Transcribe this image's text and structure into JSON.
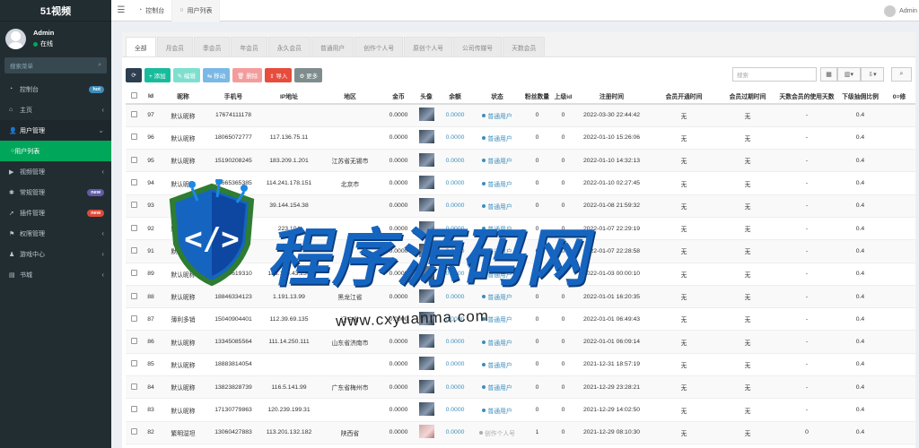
{
  "brand": "51视频",
  "user": {
    "name": "Admin",
    "status": "在线"
  },
  "sidebar": {
    "search_placeholder": "搜索菜单",
    "items": [
      {
        "label": "控制台",
        "icon": "dashboard-icon",
        "badge": "hot"
      },
      {
        "label": "主页",
        "icon": "home-icon"
      },
      {
        "label": "用户管理",
        "icon": "users-icon",
        "open": true
      },
      {
        "label": "视频管理",
        "icon": "video-icon"
      },
      {
        "label": "常规管理",
        "icon": "cogs-icon",
        "badge": "new"
      },
      {
        "label": "插件管理",
        "icon": "rocket-icon",
        "badge": "new"
      },
      {
        "label": "权限管理",
        "icon": "group-icon"
      },
      {
        "label": "游戏中心",
        "icon": "game-icon"
      },
      {
        "label": "书城",
        "icon": "book-icon"
      }
    ],
    "sub_item": "用户列表"
  },
  "topbar": {
    "tabs": [
      {
        "label": "控制台",
        "icon": "dashboard-icon"
      },
      {
        "label": "用户列表",
        "icon": "circle-icon"
      }
    ],
    "user": "Admin"
  },
  "filter_tabs": [
    "全部",
    "月会员",
    "季会员",
    "年会员",
    "永久会员",
    "普通用户",
    "创作个人号",
    "原创个人号",
    "公司传媒号",
    "天数会员"
  ],
  "toolbar": {
    "add": "+ 添加",
    "edit": "✎ 编辑",
    "move": "⇆ 移动",
    "delete": "🗑 删除",
    "import": "⇪ 导入",
    "more": "⚙ 更多",
    "search_placeholder": "搜索"
  },
  "table": {
    "headers": [
      "Id",
      "昵称",
      "手机号",
      "IP地址",
      "地区",
      "金币",
      "头像",
      "余额",
      "状态",
      "粉丝数量",
      "上级id",
      "注册时间",
      "会员开通时间",
      "会员过期时间",
      "天数会员的使用天数",
      "下级抽佣比例",
      "0=修"
    ],
    "rows": [
      [
        "97",
        "默认昵称",
        "17674111178",
        "",
        "",
        "0.0000",
        "",
        "0.0000",
        "普通用户",
        "0",
        "0",
        "2022-03-30 22:44:42",
        "无",
        "无",
        "-",
        "0.4",
        ""
      ],
      [
        "96",
        "默认昵称",
        "18065072777",
        "117.136.75.11",
        "",
        "0.0000",
        "",
        "0.0000",
        "普通用户",
        "0",
        "0",
        "2022-01-10 15:26:06",
        "无",
        "无",
        "-",
        "0.4",
        ""
      ],
      [
        "95",
        "默认昵称",
        "15190208245",
        "183.209.1.201",
        "江苏省无锡市",
        "0.0000",
        "",
        "0.0000",
        "普通用户",
        "0",
        "0",
        "2022-01-10 14:32:13",
        "无",
        "无",
        "-",
        "0.4",
        ""
      ],
      [
        "94",
        "默认昵称",
        "18665365385",
        "114.241.178.151",
        "北京市",
        "0.0000",
        "",
        "0.0000",
        "普通用户",
        "0",
        "0",
        "2022-01-10 02:27:45",
        "无",
        "无",
        "-",
        "0.4",
        ""
      ],
      [
        "93",
        "默认昵称",
        "",
        "39.144.154.38",
        "",
        "0.0000",
        "",
        "0.0000",
        "普通用户",
        "0",
        "0",
        "2022-01-08 21:59:32",
        "无",
        "无",
        "-",
        "0.4",
        ""
      ],
      [
        "92",
        "默认昵称",
        "",
        "223.104",
        "",
        "0.0000",
        "",
        "0.0000",
        "普通用户",
        "0",
        "0",
        "2022-01-07 22:29:19",
        "无",
        "无",
        "-",
        "0.4",
        ""
      ],
      [
        "91",
        "默认昵称",
        "",
        "",
        "",
        "0.0000",
        "",
        "0.0000",
        "普通用户",
        "0",
        "0",
        "2022-01-07 22:28:58",
        "无",
        "无",
        "-",
        "0.4",
        ""
      ],
      [
        "89",
        "默认昵称",
        "18030619310",
        "183.199.43.230",
        "",
        "0.0000",
        "",
        "0.0000",
        "普通用户",
        "0",
        "0",
        "2022-01-03 00:00:10",
        "无",
        "无",
        "-",
        "0.4",
        ""
      ],
      [
        "88",
        "默认昵称",
        "18846334123",
        "1.191.13.99",
        "黑龙江省",
        "0.0000",
        "",
        "0.0000",
        "普通用户",
        "0",
        "0",
        "2022-01-01 16:20:35",
        "无",
        "无",
        "-",
        "0.4",
        ""
      ],
      [
        "87",
        "薄利多销",
        "15040904401",
        "112.39.69.135",
        "辽宁省",
        "0.0000",
        "",
        "0.0000",
        "普通用户",
        "0",
        "0",
        "2022-01-01 06:49:43",
        "无",
        "无",
        "-",
        "0.4",
        ""
      ],
      [
        "86",
        "默认昵称",
        "13345085564",
        "111.14.250.111",
        "山东省济南市",
        "0.0000",
        "",
        "0.0000",
        "普通用户",
        "0",
        "0",
        "2022-01-01 06:09:14",
        "无",
        "无",
        "-",
        "0.4",
        ""
      ],
      [
        "85",
        "默认昵称",
        "18883814054",
        "",
        "",
        "0.0000",
        "",
        "0.0000",
        "普通用户",
        "0",
        "0",
        "2021-12-31 18:57:19",
        "无",
        "无",
        "-",
        "0.4",
        ""
      ],
      [
        "84",
        "默认昵称",
        "13823828739",
        "116.5.141.99",
        "广东省梅州市",
        "0.0000",
        "",
        "0.0000",
        "普通用户",
        "0",
        "0",
        "2021-12-29 23:28:21",
        "无",
        "无",
        "-",
        "0.4",
        ""
      ],
      [
        "83",
        "默认昵称",
        "17130779863",
        "120.239.199.31",
        "",
        "0.0000",
        "",
        "0.0000",
        "普通用户",
        "0",
        "0",
        "2021-12-29 14:02:50",
        "无",
        "无",
        "-",
        "0.4",
        ""
      ],
      [
        "82",
        "繁明湿坦",
        "13060427883",
        "113.201.132.182",
        "陕西省",
        "0.0000",
        "",
        "0.0000",
        "创作个人号",
        "1",
        "0",
        "2021-12-29 08:10:30",
        "无",
        "无",
        "0",
        "0.4",
        ""
      ]
    ]
  },
  "watermark": {
    "cn": "程序源码网",
    "url": "www.cxyuanma.com"
  }
}
